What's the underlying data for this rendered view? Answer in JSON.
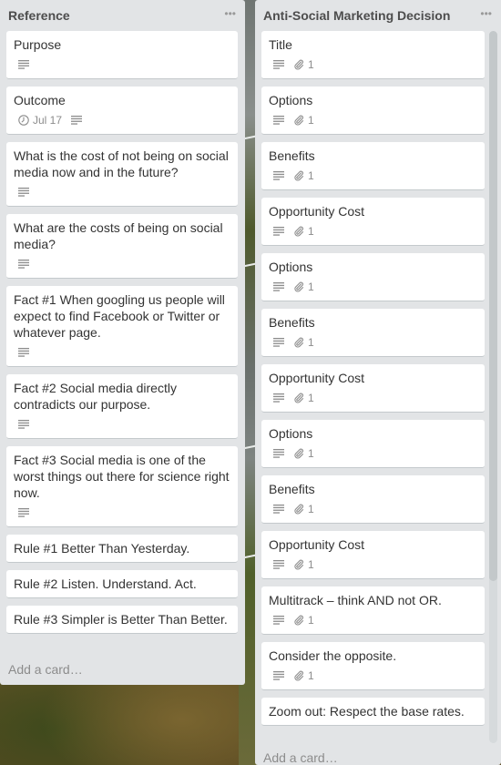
{
  "lists": [
    {
      "title": "Reference",
      "menu_icon": "ellipsis-icon",
      "add_card_label": "Add a card…",
      "cards": [
        {
          "title": "Purpose",
          "description": true
        },
        {
          "title": "Outcome",
          "due": "Jul 17",
          "description": true
        },
        {
          "title": "What is the cost of not being on social media now and in the future?",
          "description": true
        },
        {
          "title": "What are the costs of being on social media?",
          "description": true
        },
        {
          "title": "Fact #1 When googling us people will expect to find Facebook or Twitter or whatever page.",
          "description": true
        },
        {
          "title": "Fact #2 Social media directly contradicts our purpose.",
          "description": true
        },
        {
          "title": "Fact #3 Social media is one of the worst things out there for science right now.",
          "description": true
        },
        {
          "title": "Rule #1 Better Than Yesterday."
        },
        {
          "title": "Rule #2 Listen. Understand. Act."
        },
        {
          "title": "Rule #3 Simpler is Better Than Better."
        }
      ]
    },
    {
      "title": "Anti-Social Marketing Decision",
      "menu_icon": "ellipsis-icon",
      "add_card_label": "Add a card…",
      "cards": [
        {
          "title": "Title",
          "description": true,
          "attachments": "1"
        },
        {
          "title": "Options",
          "description": true,
          "attachments": "1"
        },
        {
          "title": "Benefits",
          "description": true,
          "attachments": "1"
        },
        {
          "title": "Opportunity Cost",
          "description": true,
          "attachments": "1"
        },
        {
          "title": "Options",
          "description": true,
          "attachments": "1"
        },
        {
          "title": "Benefits",
          "description": true,
          "attachments": "1"
        },
        {
          "title": "Opportunity Cost",
          "description": true,
          "attachments": "1"
        },
        {
          "title": "Options",
          "description": true,
          "attachments": "1"
        },
        {
          "title": "Benefits",
          "description": true,
          "attachments": "1"
        },
        {
          "title": "Opportunity Cost",
          "description": true,
          "attachments": "1"
        },
        {
          "title": "Multitrack – think AND not OR.",
          "description": true,
          "attachments": "1"
        },
        {
          "title": "Consider the opposite.",
          "description": true,
          "attachments": "1"
        },
        {
          "title": "Zoom out: Respect the base rates."
        }
      ]
    }
  ],
  "colors": {
    "list_bg": "#e2e4e6",
    "card_bg": "#ffffff",
    "text": "#333333",
    "muted": "#8c8c8c"
  }
}
